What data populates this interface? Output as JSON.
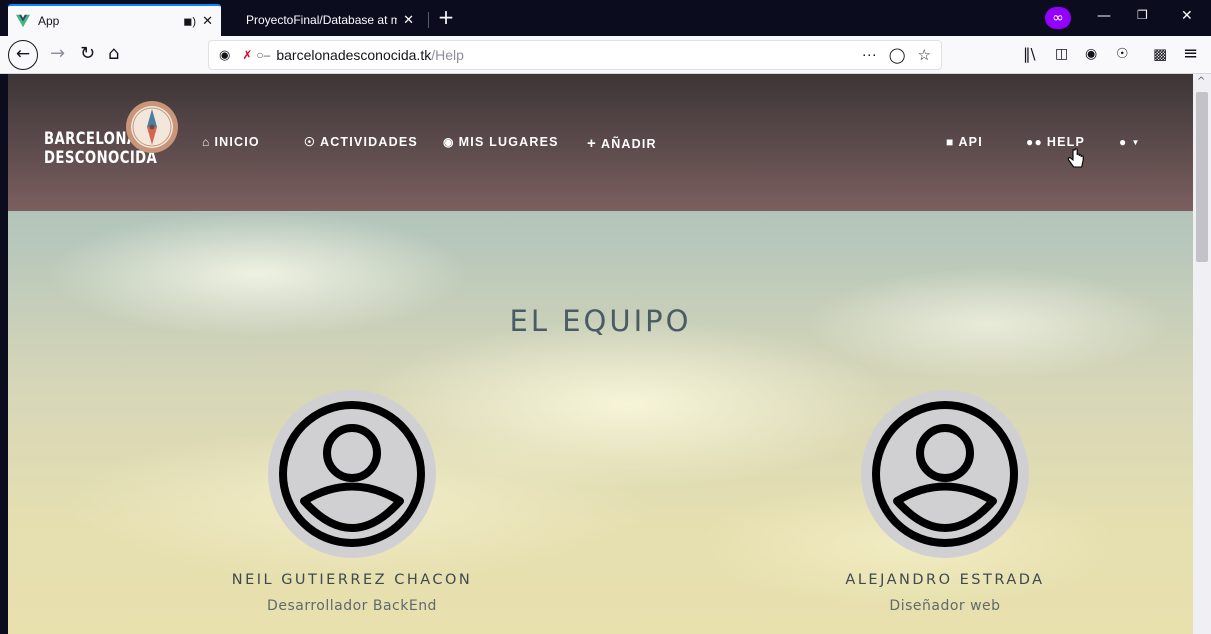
{
  "browser": {
    "active_tab": {
      "title": "App"
    },
    "inactive_tab": {
      "title": "ProyectoFinal/Database at master"
    },
    "url": {
      "host": "barcelonadesconocida.tk",
      "path": "/Help"
    }
  },
  "site": {
    "brand_line1": "BARCELONA",
    "brand_line2": "DESCONOCIDA",
    "nav": {
      "inicio": "INICIO",
      "actividades": "ACTIVIDADES",
      "mis_lugares": "MIS LUGARES",
      "anadir": "AÑADIR",
      "api": "API",
      "help": "HELP"
    }
  },
  "team": {
    "title": "EL EQUIPO",
    "members": [
      {
        "name": "NEIL GUTIERREZ CHACON",
        "role": "Desarrollador BackEnd"
      },
      {
        "name": "ALEJANDRO ESTRADA",
        "role": "Diseñador web"
      }
    ]
  },
  "colors": {
    "tab_accent": "#0a84ff",
    "navbar_top": "#3c3536",
    "navbar_bottom": "#7c5f5f",
    "title_text": "#4a5c63"
  }
}
